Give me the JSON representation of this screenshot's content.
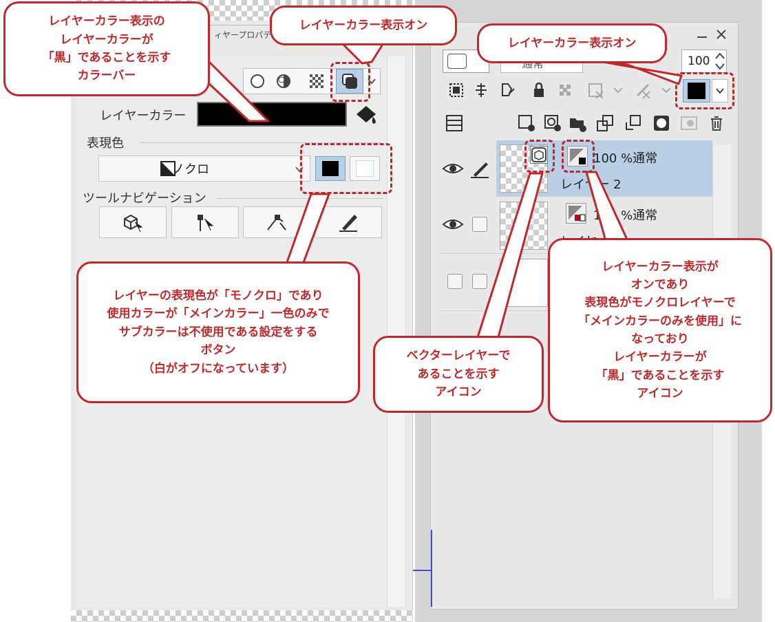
{
  "left_panel": {
    "tab_label": "ィヤープロパティ",
    "layer_color_label": "レイヤーカラー",
    "expression_color_label": "表現色",
    "expression_color_value": "モノクロ",
    "tool_nav_label": "ツールナビゲーション"
  },
  "right_panel": {
    "opacity_value": "100",
    "blend_mode_value": "通常",
    "layers": [
      {
        "opacity_blend": "100 %通常",
        "name": "レイヤー 2"
      },
      {
        "opacity_blend": "100 %通常",
        "name": "レイヤー 1"
      }
    ]
  },
  "callouts": {
    "color_bar": [
      "レイヤーカラー表示の",
      "レイヤーカラーが",
      "「黒」であることを示す",
      "カラーバー"
    ],
    "layer_color_on_left": [
      "レイヤーカラー表示オン"
    ],
    "layer_color_on_right": [
      "レイヤーカラー表示オン"
    ],
    "mono_button": [
      "レイヤーの表現色が「モノクロ」であり",
      "使用カラーが「メインカラー」一色のみで",
      "サブカラーは不使用である設定をする",
      "ボタン",
      "（白がオフになっています）"
    ],
    "vector_icon": [
      "ベクターレイヤーで",
      "あることを示す",
      "アイコン"
    ],
    "layer_color_icon": [
      "レイヤーカラー表示が",
      "オンであり",
      "表現色がモノクロレイヤーで",
      "「メインカラーのみを使用」に",
      "なっており",
      "レイヤーカラーが",
      "「黒」であることを示す",
      "アイコン"
    ]
  },
  "colors": {
    "callout_red": "#c0282b",
    "layer_color": "#000000",
    "selected_row": "#b9cfe6"
  },
  "icons": [
    "circle-mode-icon",
    "half-tone-icon",
    "dither-icon",
    "layer-color-display-icon",
    "bucket-icon",
    "monochrome-icon",
    "vector-layer-icon",
    "layer-color-indicator-icon",
    "eye-icon",
    "pen-icon",
    "trash-icon"
  ]
}
